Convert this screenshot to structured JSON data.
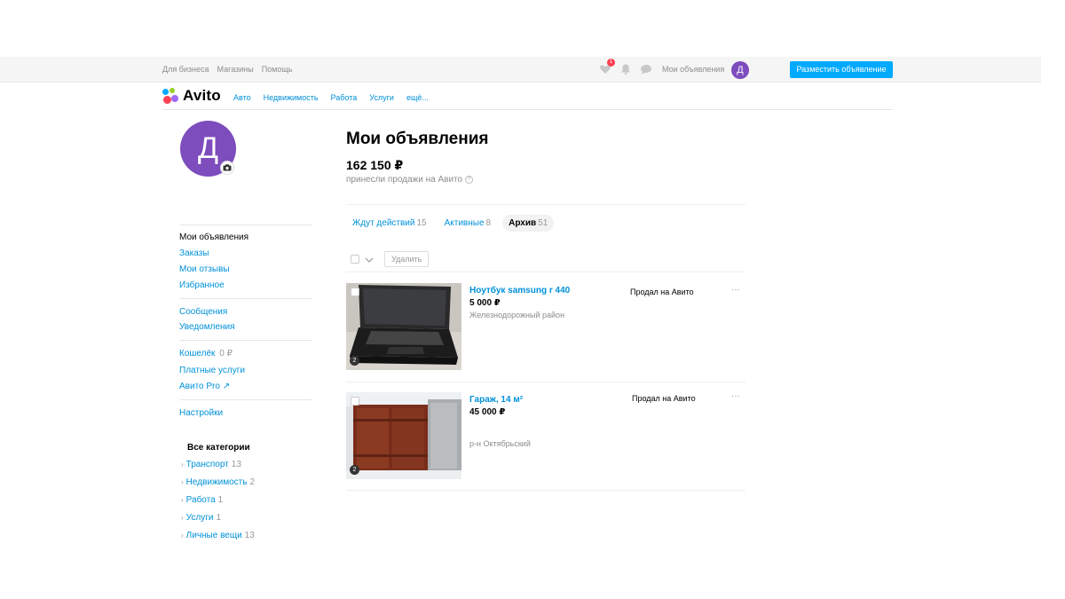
{
  "topbar": {
    "links": [
      "Для бизнеса",
      "Магазины",
      "Помощь"
    ],
    "favorites_badge": "1",
    "my_ads": "Мои объявления",
    "avatar_letter": "Д",
    "post_button": "Разместить объявление"
  },
  "header": {
    "logo_text": "Avito",
    "nav": [
      "Авто",
      "Недвижимость",
      "Работа",
      "Услуги",
      "ещё..."
    ]
  },
  "sidebar": {
    "avatar_letter": "Д",
    "menu_groups": [
      [
        {
          "label": "Мои объявления",
          "active": true
        },
        {
          "label": "Заказы"
        },
        {
          "label": "Мои отзывы"
        },
        {
          "label": "Избранное"
        }
      ],
      [
        {
          "label": "Сообщения"
        },
        {
          "label": "Уведомления"
        }
      ],
      [
        {
          "label": "Кошелёк",
          "value": "0 ₽"
        },
        {
          "label": "Платные услуги"
        },
        {
          "label": "Авито Pro ↗"
        }
      ],
      [
        {
          "label": "Настройки"
        }
      ]
    ],
    "categories_title": "Все категории",
    "categories": [
      {
        "label": "Транспорт",
        "count": "13"
      },
      {
        "label": "Недвижимость",
        "count": "2"
      },
      {
        "label": "Работа",
        "count": "1"
      },
      {
        "label": "Услуги",
        "count": "1"
      },
      {
        "label": "Личные вещи",
        "count": "13"
      }
    ]
  },
  "main": {
    "title": "Мои объявления",
    "earned": "162 150 ₽",
    "earned_sub": "принесли продажи на Авито",
    "tabs": [
      {
        "label": "Ждут действий",
        "count": "15",
        "active": false
      },
      {
        "label": "Активные",
        "count": "8",
        "active": false
      },
      {
        "label": "Архив",
        "count": "51",
        "active": true
      }
    ],
    "delete_button": "Удалить",
    "listings": [
      {
        "title": "Ноутбук samsung r 440",
        "price": "5 000 ₽",
        "location": "Железнодорожный район",
        "status": "Продал на Авито",
        "photos": "2"
      },
      {
        "title": "Гараж, 14 м²",
        "price": "45 000 ₽",
        "location": "р-н Октябрьский",
        "status": "Продал на Авито",
        "photos": "2"
      }
    ]
  },
  "colors": {
    "accent": "#00aaff",
    "link": "#0091d9",
    "avatar": "#7d4cbd",
    "badge": "#ff4053"
  }
}
